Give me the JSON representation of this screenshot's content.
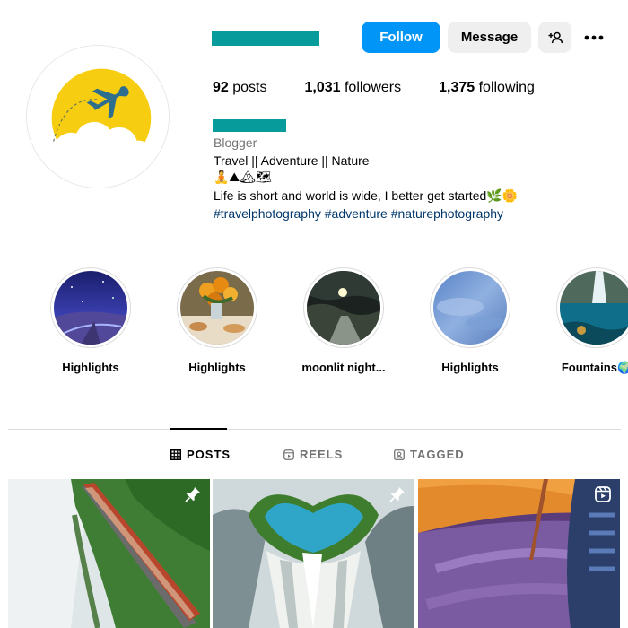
{
  "profile": {
    "follow_label": "Follow",
    "message_label": "Message"
  },
  "stats": {
    "posts_count": "92",
    "posts_label": " posts",
    "followers_count": "1,031",
    "followers_label": " followers",
    "following_count": "1,375",
    "following_label": " following"
  },
  "bio": {
    "category": "Blogger",
    "line1": "Travel || Adventure || Nature",
    "emoji_line": "🧘⛰🏔🗺",
    "line3": "Life is short and world is wide, I better get started",
    "line3_emoji": "🌿🌼",
    "hashtags": "#travelphotography #adventure #naturephotography"
  },
  "highlights": [
    {
      "label": "Highlights"
    },
    {
      "label": "Highlights"
    },
    {
      "label": "moonlit night..."
    },
    {
      "label": "Highlights"
    },
    {
      "label": "Fountains🌍"
    }
  ],
  "tabs": {
    "posts": "POSTS",
    "reels": "REELS",
    "tagged": "TAGGED"
  },
  "icons": {
    "add_user": "add-user-icon",
    "more": "more-horizontal-icon",
    "posts_tab": "grid-icon",
    "reels_tab": "reels-icon",
    "tagged_tab": "tagged-icon",
    "pinned": "pin-icon",
    "reel_badge": "reel-icon"
  },
  "colors": {
    "follow_button": "#0095f6",
    "secondary_button": "#efefef",
    "hashtag": "#00376b",
    "muted": "#737373",
    "redaction": "#079b9b"
  }
}
